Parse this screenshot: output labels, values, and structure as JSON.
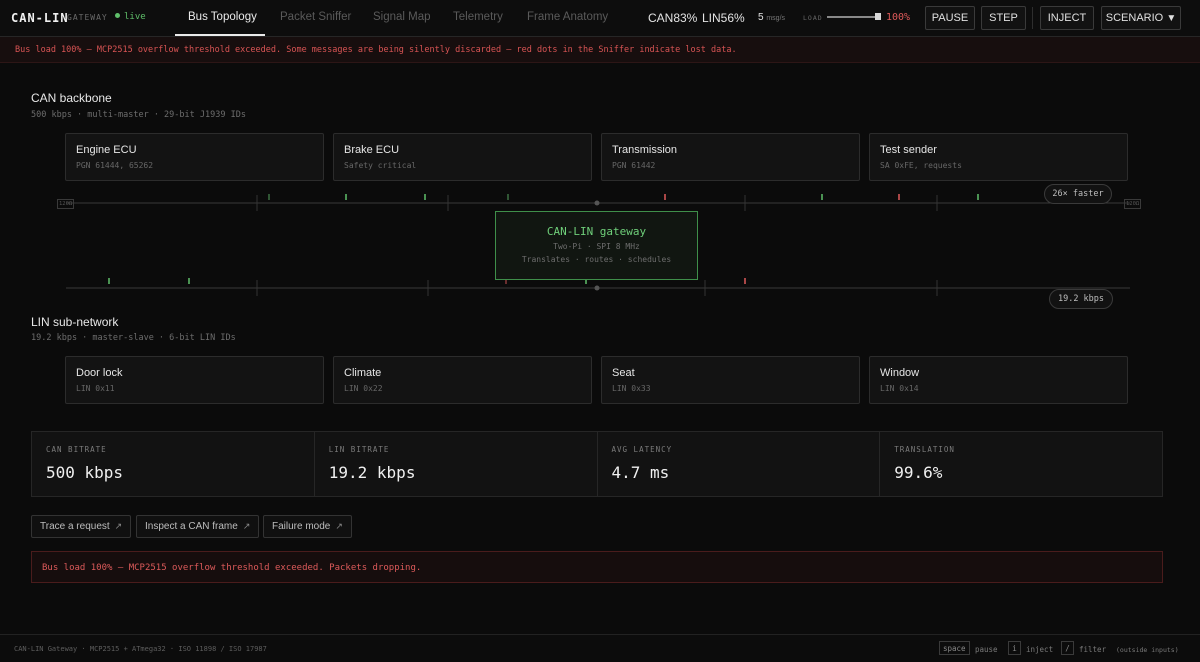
{
  "header": {
    "brand": "CAN-LIN",
    "brand_sub": "GATEWAY",
    "live": "live",
    "tabs": [
      {
        "label": "Bus Topology",
        "active": true
      },
      {
        "label": "Packet Sniffer",
        "active": false
      },
      {
        "label": "Signal Map",
        "active": false
      },
      {
        "label": "Telemetry",
        "active": false
      },
      {
        "label": "Frame Anatomy",
        "active": false
      }
    ],
    "can_load": "CAN83%",
    "lin_load": "LIN56%",
    "rate_value": "5",
    "rate_unit": "msg/s",
    "load_label": "LOAD",
    "load_value": "100%",
    "load_level": 1.0,
    "pause_label": "PAUSE",
    "step_label": "STEP",
    "inject_label": "INJECT",
    "scenario_label": "SCENARIO"
  },
  "warning_banner": "Bus load 100% — MCP2515 overflow threshold exceeded. Some messages are being silently discarded — red dots in the Sniffer indicate lost data.",
  "can": {
    "title": "CAN backbone",
    "subtitle": "500 kbps · multi-master · 29-bit J1939 IDs",
    "nodes": [
      {
        "name": "Engine ECU",
        "sub": "PGN 61444, 65262"
      },
      {
        "name": "Brake ECU",
        "sub": "Safety critical"
      },
      {
        "name": "Transmission",
        "sub": "PGN 61442"
      },
      {
        "name": "Test sender",
        "sub": "SA 0xFE, requests"
      }
    ],
    "speed_pill": "26× faster",
    "endcap": "120Ω"
  },
  "gateway": {
    "title": "CAN-LIN gateway",
    "line1": "Two-Pi · SPI 8 MHz",
    "line2": "Translates · routes · schedules"
  },
  "lin": {
    "title": "LIN sub-network",
    "subtitle": "19.2 kbps · master-slave · 6-bit LIN IDs",
    "nodes": [
      {
        "name": "Door lock",
        "sub": "LIN 0x11"
      },
      {
        "name": "Climate",
        "sub": "LIN 0x22"
      },
      {
        "name": "Seat",
        "sub": "LIN 0x33"
      },
      {
        "name": "Window",
        "sub": "LIN 0x14"
      }
    ],
    "speed_pill": "19.2 kbps"
  },
  "stats": [
    {
      "label": "CAN BITRATE",
      "value": "500 kbps"
    },
    {
      "label": "LIN BITRATE",
      "value": "19.2 kbps"
    },
    {
      "label": "AVG LATENCY",
      "value": "4.7 ms"
    },
    {
      "label": "TRANSLATION",
      "value": "99.6%"
    }
  ],
  "links": [
    {
      "label": "Trace a request",
      "icon": "arrow-up-right-icon"
    },
    {
      "label": "Inspect a CAN frame",
      "icon": "arrow-up-right-icon"
    },
    {
      "label": "Failure mode",
      "icon": "arrow-up-right-icon"
    }
  ],
  "alert": "Bus load 100% — MCP2515 overflow threshold exceeded. Packets dropping.",
  "footer": {
    "left": "CAN-LIN Gateway · MCP2515 + ATmega32 · ISO 11898 / ISO 17987",
    "key_space": "space",
    "space_action": "pause",
    "key_i": "i",
    "i_action": "inject",
    "key_slash": "/",
    "slash_action": "filter",
    "note": "(outside inputs)"
  },
  "colors": {
    "ok": "#5fbf6a",
    "error": "#e05a5a",
    "gateway": "#3f8f4a"
  }
}
